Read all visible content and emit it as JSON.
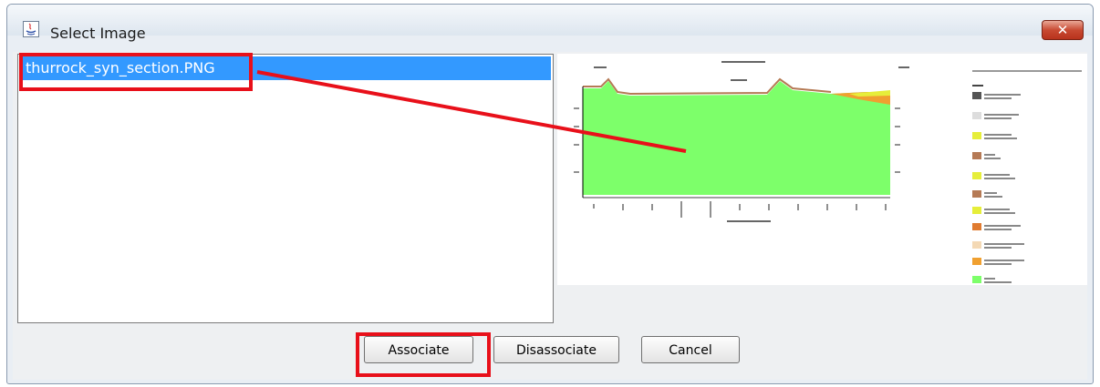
{
  "window": {
    "title": "Select Image",
    "close_glyph": "✕",
    "app_icon": "java-app-icon"
  },
  "image_list": {
    "items": [
      {
        "label": "thurrock_syn_section.PNG",
        "selected": true
      }
    ]
  },
  "preview": {
    "description_icon": "cross-section-preview-image",
    "colors": {
      "fill": "#7dff6a",
      "accent_brown": "#b57a55",
      "accent_orange": "#f0a030",
      "accent_yellow": "#e6ee3a"
    }
  },
  "buttons": {
    "associate": "Associate",
    "disassociate": "Disassociate",
    "cancel": "Cancel"
  },
  "annotation": {
    "color": "#e8101a"
  }
}
